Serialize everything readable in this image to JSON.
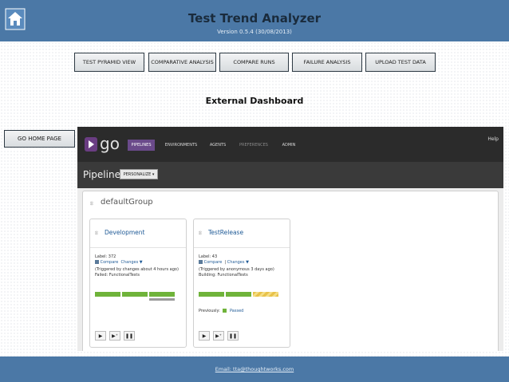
{
  "header": {
    "title": "Test Trend Analyzer",
    "version": "Version 0.5.4 (30/08/2013)",
    "home_icon": "home-icon"
  },
  "nav": {
    "items": [
      {
        "label": "TEST PYRAMID VIEW"
      },
      {
        "label": "COMPARATIVE ANALYSIS"
      },
      {
        "label": "COMPARE RUNS"
      },
      {
        "label": "FAILURE ANALYSIS"
      },
      {
        "label": "UPLOAD TEST DATA"
      }
    ]
  },
  "main": {
    "title": "External Dashboard",
    "home_button": "GO HOME PAGE"
  },
  "go": {
    "logo": "go",
    "nav": [
      "PIPELINES",
      "ENVIRONMENTS",
      "AGENTS",
      "PREFERENCES",
      "ADMIN"
    ],
    "help": "Help",
    "pipelines_label": "Pipelines",
    "personalize": "PERSONALIZE ▾",
    "group": "defaultGroup",
    "pipelines": [
      {
        "name": "Development",
        "label": "Label: 372",
        "compare": "Compare",
        "changes": "Changes ▼",
        "trigger": "(Triggered by changes about 4 hours ago)",
        "status": "Failed: FunctionalTests"
      },
      {
        "name": "TestRelease",
        "label": "Label: 43",
        "compare": "Compare",
        "changes": "Changes ▼",
        "trigger": "(Triggered by anonymous 3 days ago)",
        "status": "Building: FunctionalTests",
        "previously": "Previously:",
        "previous_status": "Passed"
      }
    ],
    "colors": {
      "passed": "#6fb33a",
      "building": "#e8c24a",
      "active_nav": "#6a4a8a"
    }
  },
  "footer": {
    "email": "Email: tta@thoughtworks.com"
  }
}
